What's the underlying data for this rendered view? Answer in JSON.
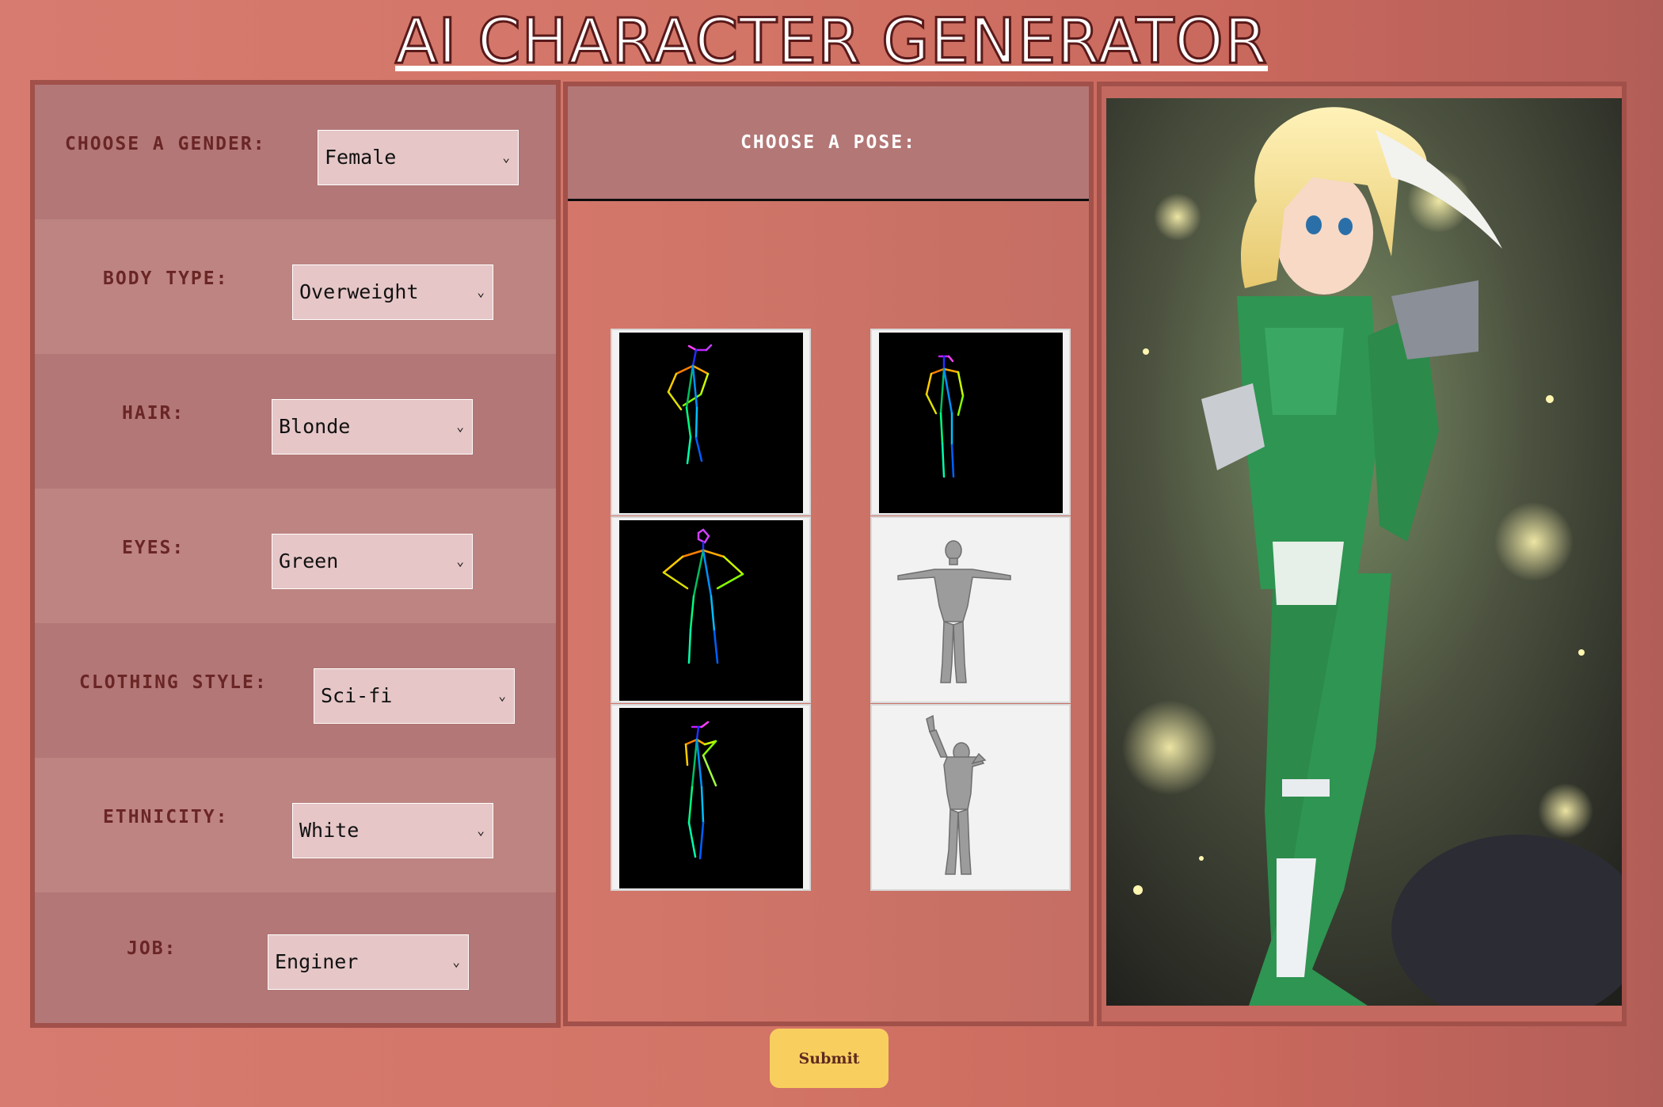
{
  "title": "AI CHARACTER GENERATOR",
  "form": {
    "rows": [
      {
        "label": "CHOOSE A GENDER:",
        "value": "Female"
      },
      {
        "label": "BODY TYPE:",
        "value": "Overweight"
      },
      {
        "label": "HAIR:",
        "value": "Blonde"
      },
      {
        "label": "EYES:",
        "value": "Green"
      },
      {
        "label": "CLOTHING STYLE:",
        "value": "Sci-fi"
      },
      {
        "label": "ETHNICITY:",
        "value": "White"
      },
      {
        "label": "JOB:",
        "value": "Enginer"
      }
    ]
  },
  "pose": {
    "title": "CHOOSE A POSE:",
    "options": [
      "stick-figure-standing",
      "stick-figure-arms-down",
      "stick-figure-hands-on-hips",
      "mannequin-t-pose",
      "stick-figure-hand-raised",
      "mannequin-arm-raised"
    ]
  },
  "preview": {
    "description_icon": "generated-character-image"
  },
  "submit_label": "Submit",
  "colors": {
    "panel_border": "#a2504a",
    "submit": "#f8cf5f",
    "label": "#6a2525",
    "select_bg": "#e6c6c7"
  }
}
